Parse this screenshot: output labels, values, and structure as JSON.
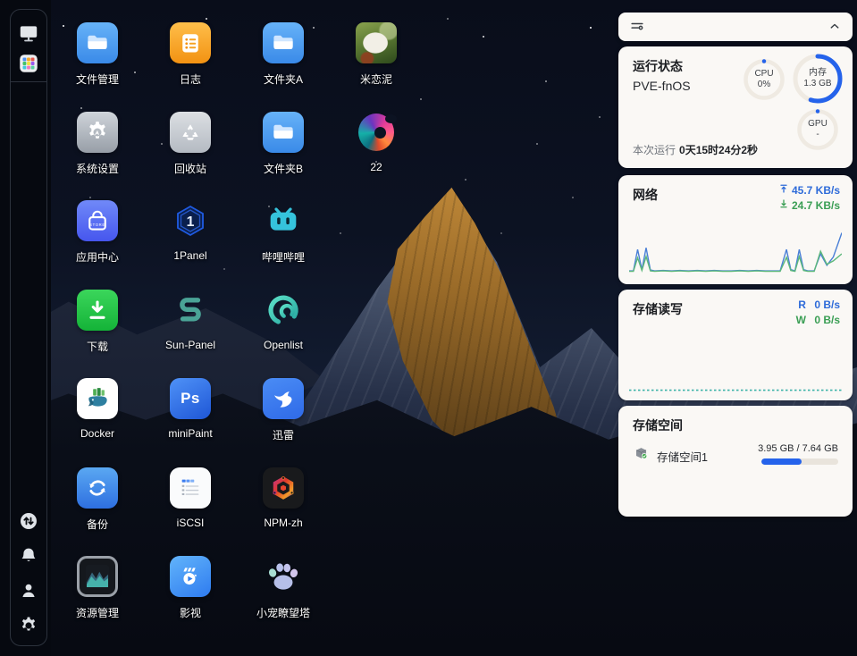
{
  "sidebar": {
    "top_icons": [
      "desktop-view",
      "app-launcher"
    ],
    "bottom_icons": [
      "transfer-activity",
      "notifications",
      "user",
      "settings"
    ]
  },
  "desktop": {
    "apps": [
      {
        "label": "文件管理",
        "icon": "file-manager"
      },
      {
        "label": "系统设置",
        "icon": "system-settings"
      },
      {
        "label": "应用中心",
        "icon": "app-center"
      },
      {
        "label": "下载",
        "icon": "download"
      },
      {
        "label": "Docker",
        "icon": "docker"
      },
      {
        "label": "备份",
        "icon": "backup"
      },
      {
        "label": "资源管理",
        "icon": "resource-monitor"
      },
      {
        "label": "日志",
        "icon": "log"
      },
      {
        "label": "回收站",
        "icon": "recycle-bin"
      },
      {
        "label": "1Panel",
        "icon": "one-panel"
      },
      {
        "label": "Sun-Panel",
        "icon": "sun-panel"
      },
      {
        "label": "miniPaint",
        "icon": "minipaint"
      },
      {
        "label": "iSCSI",
        "icon": "iscsi"
      },
      {
        "label": "影视",
        "icon": "movies"
      },
      {
        "label": "文件夹A",
        "icon": "folder"
      },
      {
        "label": "文件夹B",
        "icon": "folder2"
      },
      {
        "label": "哔哩哔哩",
        "icon": "bilibili"
      },
      {
        "label": "Openlist",
        "icon": "openlist"
      },
      {
        "label": "迅雷",
        "icon": "xunlei"
      },
      {
        "label": "NPM-zh",
        "icon": "npm"
      },
      {
        "label": "小宠瞭望塔",
        "icon": "paw"
      },
      {
        "label": "米恋泥",
        "icon": "photo-cat"
      },
      {
        "label": "22",
        "icon": "swirl"
      }
    ]
  },
  "panel": {
    "topbar": {
      "left_icon": "widget-settings-icon",
      "right_icon": "collapse-up-icon"
    },
    "status": {
      "title": "运行状态",
      "host": "PVE-fnOS",
      "rings": [
        {
          "label": "CPU",
          "value": "0%",
          "percent": 0
        },
        {
          "label": "内存",
          "value": "1.3 GB",
          "percent": 55
        },
        {
          "label": "GPU",
          "value": "-",
          "percent": 0
        }
      ],
      "uptime_label": "本次运行",
      "uptime_value": "0天15时24分2秒"
    },
    "network": {
      "title": "网络",
      "upload": "45.7 KB/s",
      "download": "24.7 KB/s"
    },
    "disk_io": {
      "title": "存储读写",
      "read_label": "R",
      "read_value": "0 B/s",
      "write_label": "W",
      "write_value": "0 B/s"
    },
    "storage": {
      "title": "存储空间",
      "volumes": [
        {
          "name": "存储空间1",
          "usage": "3.95 GB / 7.64 GB",
          "percent": 52
        }
      ]
    }
  },
  "colors": {
    "accent_blue": "#2563eb",
    "net_up": "#2e6bd9",
    "net_down": "#3a9e54",
    "card_bg": "#faf8f5",
    "sidebar_bg": "#060910"
  },
  "chart_data": [
    {
      "type": "line",
      "title": "网络",
      "x": [
        0,
        2,
        4,
        6,
        8,
        10,
        12,
        16,
        20,
        24,
        28,
        32,
        36,
        40,
        44,
        48,
        52,
        56,
        60,
        64,
        68,
        71,
        74,
        76,
        78,
        80,
        82,
        84,
        87,
        90,
        93,
        96,
        100
      ],
      "series": [
        {
          "name": "上传",
          "color": "#4a7fd6",
          "values": [
            3,
            3,
            52,
            6,
            56,
            5,
            3,
            4,
            3,
            4,
            3,
            4,
            3,
            4,
            3,
            3,
            4,
            3,
            4,
            3,
            3,
            3,
            52,
            6,
            3,
            52,
            6,
            3,
            3,
            42,
            16,
            35,
            90
          ]
        },
        {
          "name": "下载",
          "color": "#5cb87a",
          "values": [
            2,
            2,
            33,
            4,
            36,
            3,
            2,
            3,
            2,
            3,
            2,
            3,
            2,
            3,
            2,
            2,
            3,
            2,
            3,
            2,
            2,
            2,
            34,
            4,
            2,
            36,
            4,
            2,
            2,
            48,
            18,
            26,
            42
          ]
        }
      ],
      "ylim": [
        0,
        100
      ],
      "grid": false,
      "legend": "none"
    },
    {
      "type": "line",
      "title": "存储读写",
      "x": [
        0,
        100
      ],
      "series": [
        {
          "name": "读",
          "color": "#4a7fd6",
          "values": [
            0,
            0
          ]
        },
        {
          "name": "写",
          "color": "#35b5a0",
          "values": [
            0,
            0
          ]
        }
      ],
      "ylim": [
        0,
        100
      ],
      "grid": false,
      "legend": "none"
    }
  ]
}
